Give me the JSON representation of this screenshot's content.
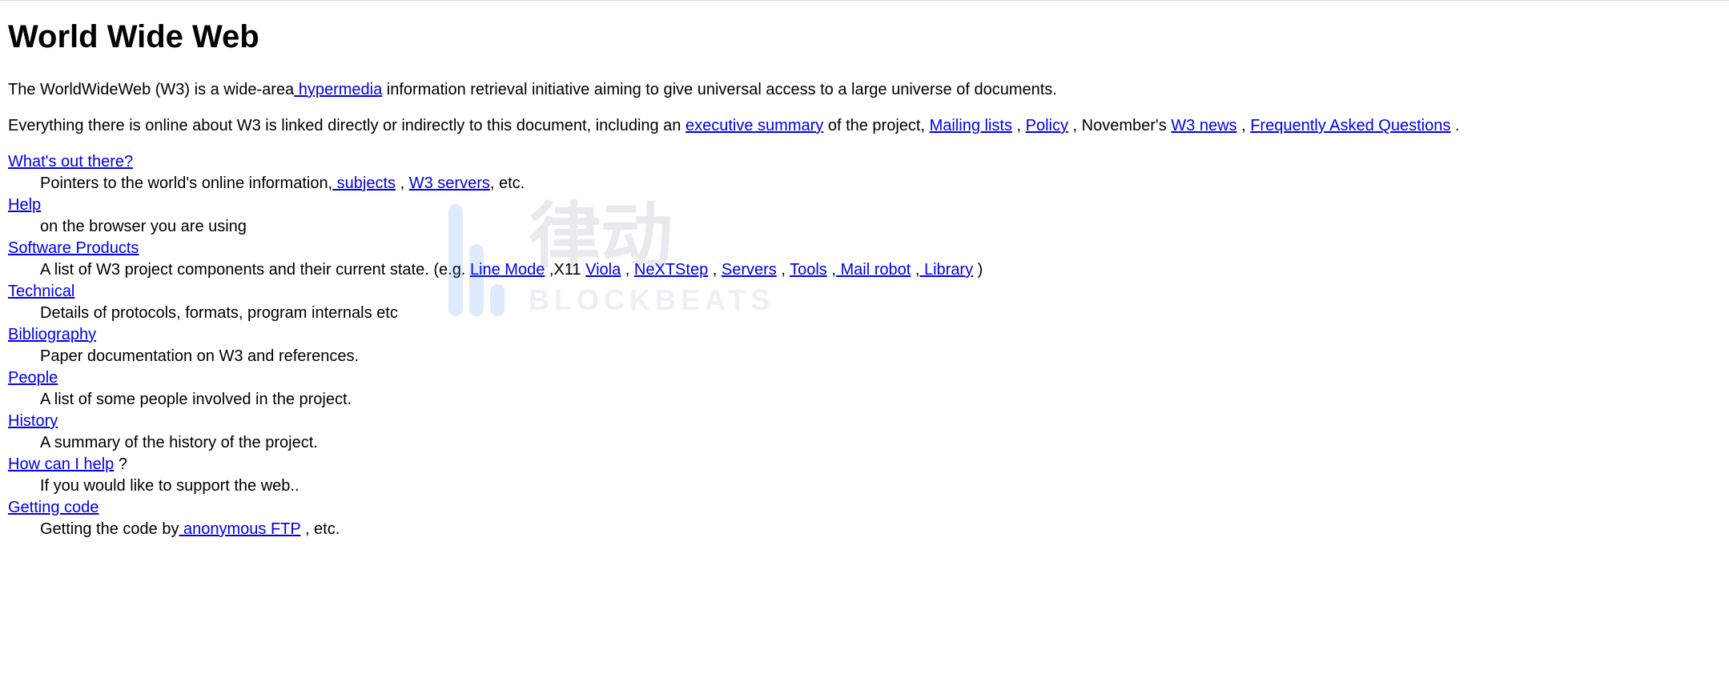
{
  "title": "World Wide Web",
  "intro": {
    "pre": "The WorldWideWeb (W3) is a wide-area",
    "hypermedia": " hypermedia",
    "post": " information retrieval initiative aiming to give universal access to a large universe of documents."
  },
  "para2": {
    "s1": "Everything there is online about W3 is linked directly or indirectly to this document, including an ",
    "exec_summary": "executive summary",
    "s2": " of the project, ",
    "mailing_lists": "Mailing lists",
    "s3": " , ",
    "policy": "Policy",
    "s4": " , November's ",
    "w3news": "W3 news",
    "s5": " , ",
    "faq": "Frequently Asked Questions",
    "s6": " ."
  },
  "list": {
    "whats": {
      "term": "What's out there?",
      "d1": "Pointers to the world's online information,",
      "subjects": " subjects",
      "d2": " , ",
      "w3servers": "W3 servers",
      "d3": ", etc."
    },
    "help": {
      "term": "Help",
      "desc": "on the browser you are using"
    },
    "software": {
      "term": "Software Products",
      "d1": "A list of W3 project components and their current state. (e.g. ",
      "linemode": "Line Mode",
      "d2": " ,X11 ",
      "viola": "Viola",
      "d3": " , ",
      "nextstep": "NeXTStep",
      "d4": " , ",
      "servers": "Servers",
      "d5": " , ",
      "tools": "Tools",
      "d6": " ,",
      "mailrobot": " Mail robot",
      "d7": " ,",
      "library": " Library",
      "d8": " )"
    },
    "technical": {
      "term": "Technical",
      "desc": "Details of protocols, formats, program internals etc"
    },
    "biblio": {
      "term": "Bibliography",
      "desc": "Paper documentation on W3 and references."
    },
    "people": {
      "term": "People",
      "desc": "A list of some people involved in the project."
    },
    "history": {
      "term": "History",
      "desc": "A summary of the history of the project."
    },
    "howhelp": {
      "term": "How can I help",
      "qm": " ?",
      "desc": "If you would like to support the web.."
    },
    "getting": {
      "term": "Getting code",
      "d1": "Getting the code by",
      "anonftp": " anonymous FTP",
      "d2": " , etc."
    }
  },
  "watermark": {
    "cjk": "律动",
    "en": "BLOCKBEATS"
  }
}
